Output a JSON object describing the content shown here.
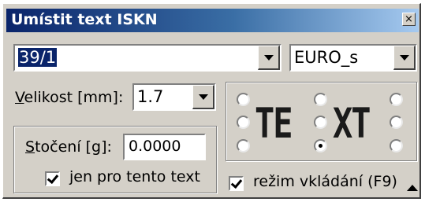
{
  "window": {
    "title": "Umístit text ISKN",
    "close_glyph": "×"
  },
  "parcel_combo": {
    "value": "39/1"
  },
  "font_combo": {
    "value": "EURO_s"
  },
  "size": {
    "label_prefix": "",
    "label_underlined": "V",
    "label_rest": "elikost [mm]:",
    "value": "1.7"
  },
  "rotation": {
    "label_underlined": "S",
    "label_rest": "točení [g]:",
    "value": "0.0000",
    "checkbox_label": "jen pro tento text",
    "checked": true
  },
  "anchor": {
    "text_left": "TE",
    "text_right": "XT",
    "selected": "bottom-center"
  },
  "insert_mode": {
    "label": "režim vkládání (F9)",
    "checked": true
  },
  "icons": {
    "close": "close-icon",
    "dropdown": "chevron-down-icon",
    "collapse": "arrow-up-icon",
    "checkbox": "checkmark-icon"
  }
}
